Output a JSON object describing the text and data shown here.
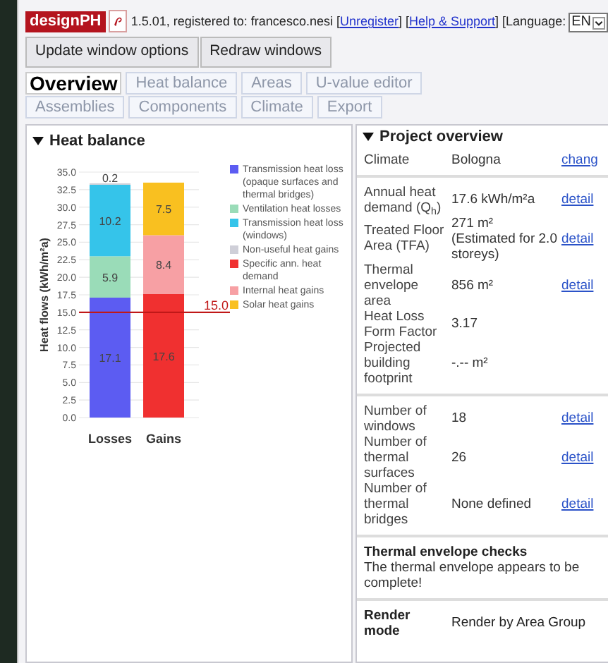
{
  "header": {
    "logo": "designPH",
    "segments": [
      {
        "kind": "text",
        "text": "1.5.01, registered to: francesco.nesi ["
      },
      {
        "kind": "link",
        "text": "Unregister"
      },
      {
        "kind": "text",
        "text": "] ["
      },
      {
        "kind": "link",
        "text": "Help & Support"
      },
      {
        "kind": "text",
        "text": "] [Language:"
      },
      {
        "kind": "select",
        "text": "EN"
      }
    ],
    "buttons": [
      "Update window options",
      "Redraw windows"
    ]
  },
  "tabs": [
    {
      "label": "Overview",
      "selected": true
    },
    {
      "label": "Heat balance",
      "selected": false
    },
    {
      "label": "Areas",
      "selected": false
    },
    {
      "label": "U-value editor",
      "selected": false
    },
    {
      "label": "Assemblies",
      "selected": false
    },
    {
      "label": "Components",
      "selected": false
    },
    {
      "label": "Climate",
      "selected": false
    },
    {
      "label": "Export",
      "selected": false
    }
  ],
  "heat_balance": {
    "title": "Heat balance",
    "expanded": true,
    "chart_data": {
      "type": "bar",
      "stacked": true,
      "ylabel": "Heat flows (kWh/m²a)",
      "categories": [
        "Losses",
        "Gains"
      ],
      "ylim": [
        0,
        35
      ],
      "yticks": [
        {
          "value": 0,
          "label": "0.0"
        },
        {
          "value": 2.5,
          "label": "2.5"
        },
        {
          "value": 5,
          "label": "5.0"
        },
        {
          "value": 7.5,
          "label": "7.5"
        },
        {
          "value": 10,
          "label": "10.0"
        },
        {
          "value": 12.5,
          "label": "12.5"
        },
        {
          "value": 15,
          "label": "15.0"
        },
        {
          "value": 17.5,
          "label": "17.5"
        },
        {
          "value": 20,
          "label": "20.0"
        },
        {
          "value": 22.5,
          "label": "22.5"
        },
        {
          "value": 25,
          "label": "25.0"
        },
        {
          "value": 27.5,
          "label": "27.5"
        },
        {
          "value": 30,
          "label": "30.0"
        },
        {
          "value": 32.5,
          "label": "32.5"
        },
        {
          "value": 35,
          "label": "35.0"
        }
      ],
      "series": [
        {
          "name": "Transmission heat loss (opaque surfaces and thermal bridges)",
          "color": "#5c5cf2",
          "values": [
            17.1,
            null
          ]
        },
        {
          "name": "Ventilation heat losses",
          "color": "#9adcb8",
          "values": [
            5.9,
            null
          ]
        },
        {
          "name": "Transmission heat loss (windows)",
          "color": "#35c4ea",
          "values": [
            10.2,
            null
          ]
        },
        {
          "name": "Non-useful heat gains",
          "color": "#cfcfd8",
          "values": [
            0.2,
            null
          ]
        },
        {
          "name": "Specific ann. heat demand",
          "color": "#f03030",
          "values": [
            null,
            17.6
          ]
        },
        {
          "name": "Internal heat gains",
          "color": "#f7a0a4",
          "values": [
            null,
            8.4
          ]
        },
        {
          "name": "Solar heat gains",
          "color": "#f9c020",
          "values": [
            null,
            7.5
          ]
        }
      ],
      "data_labels": true,
      "grid": true,
      "ref_lines": [
        {
          "axis": "y",
          "value": 15,
          "label": "15.0",
          "color": "#c01818"
        }
      ]
    }
  },
  "project_overview": {
    "title": "Project overview",
    "expanded": true,
    "groups": [
      [
        {
          "label": "Climate",
          "value": "Bologna",
          "link": "chang"
        }
      ],
      [
        {
          "label": "Annual heat demand (Q$_{h}$)",
          "value": "17.6 kWh/m²a",
          "link": "detail"
        },
        {
          "label": "Treated Floor Area (TFA)",
          "value": "271 m² (Estimated for 2.0 storeys)",
          "link": "detail"
        },
        {
          "label": "Thermal envelope area",
          "value": "856 m²",
          "link": "detail"
        },
        {
          "label": "Heat Loss Form Factor",
          "value": "3.17"
        },
        {
          "label": "Projected building footprint",
          "value": "-.-- m²"
        }
      ],
      [
        {
          "label": "Number of windows",
          "value": "18",
          "link": "detail"
        },
        {
          "label": "Number of thermal surfaces",
          "value": "26",
          "link": "detail"
        },
        {
          "label": "Number of thermal bridges",
          "value": "None defined",
          "link": "detail"
        }
      ]
    ],
    "checks": {
      "title": "Thermal envelope checks",
      "text": "The thermal envelope appears to be complete!"
    },
    "render": {
      "label": "Render mode",
      "value": "Render by Area Group"
    }
  }
}
